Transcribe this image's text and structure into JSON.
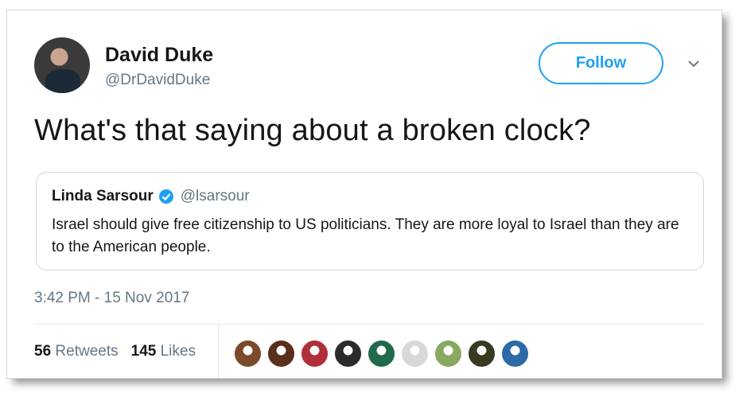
{
  "author": {
    "name": "David Duke",
    "handle": "@DrDavidDuke",
    "follow_label": "Follow"
  },
  "tweet": {
    "text": "What's that saying about a broken clock?",
    "timestamp": "3:42 PM - 15 Nov 2017"
  },
  "quoted_tweet": {
    "name": "Linda Sarsour",
    "handle": "@lsarsour",
    "verified": true,
    "text": "Israel should give free citizenship to US politicians. They are more loyal to Israel than they are to the American people."
  },
  "stats": {
    "retweets_count": "56",
    "retweets_label": "Retweets",
    "likes_count": "145",
    "likes_label": "Likes"
  },
  "likers": [
    {
      "name": "liker-avatar-1",
      "color": "#7a4a2a"
    },
    {
      "name": "liker-avatar-2",
      "color": "#5a2f1c"
    },
    {
      "name": "liker-avatar-3",
      "color": "#b0303a"
    },
    {
      "name": "liker-avatar-4",
      "color": "#2b2b2b"
    },
    {
      "name": "liker-avatar-5",
      "color": "#1f6a4a"
    },
    {
      "name": "liker-avatar-6",
      "color": "#d8d8d8"
    },
    {
      "name": "liker-avatar-7",
      "color": "#8aa860"
    },
    {
      "name": "liker-avatar-8",
      "color": "#3a3a20"
    },
    {
      "name": "liker-avatar-9",
      "color": "#2c6aa8"
    }
  ],
  "colors": {
    "accent": "#1da1f2",
    "text": "#14171a",
    "muted": "#657786"
  }
}
